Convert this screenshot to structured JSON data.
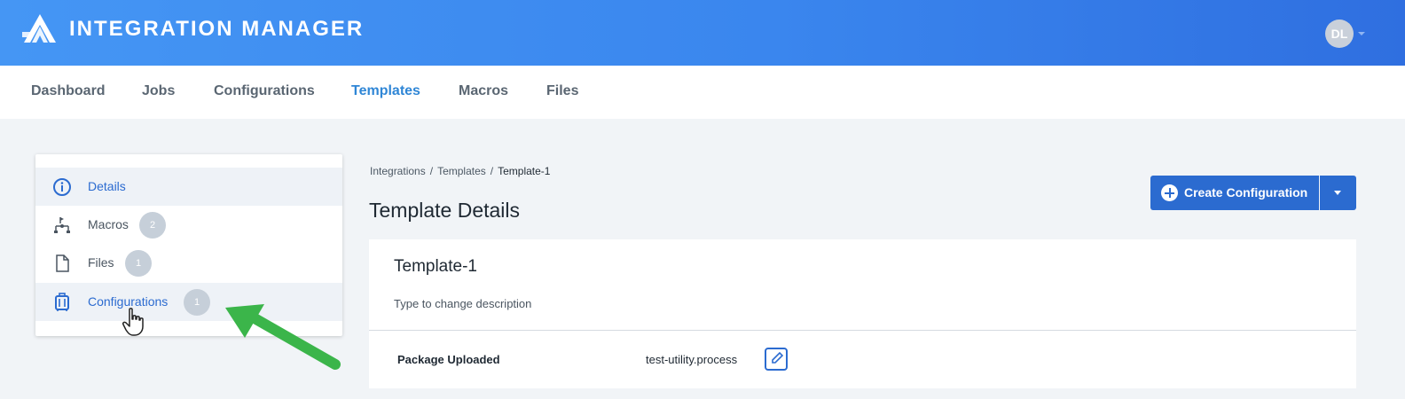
{
  "app": {
    "title": "INTEGRATION MANAGER",
    "logo_icon": "chevron-stack-logo",
    "user_initials": "DL"
  },
  "topnav": {
    "items": [
      {
        "label": "Dashboard",
        "active": false
      },
      {
        "label": "Jobs",
        "active": false
      },
      {
        "label": "Configurations",
        "active": false
      },
      {
        "label": "Templates",
        "active": true
      },
      {
        "label": "Macros",
        "active": false
      },
      {
        "label": "Files",
        "active": false
      }
    ]
  },
  "sidebar": {
    "items": [
      {
        "label": "Details",
        "icon": "info-icon",
        "badge": null
      },
      {
        "label": "Macros",
        "icon": "flowchart-icon",
        "badge": "2"
      },
      {
        "label": "Files",
        "icon": "file-icon",
        "badge": "1"
      },
      {
        "label": "Configurations",
        "icon": "luggage-icon",
        "badge": "1"
      }
    ]
  },
  "breadcrumb": {
    "items": [
      "Integrations",
      "Templates",
      "Template-1"
    ]
  },
  "page": {
    "title": "Template Details"
  },
  "actions": {
    "create_label": "Create Configuration"
  },
  "template": {
    "name": "Template-1",
    "description": "Type to change description",
    "package_label": "Package Uploaded",
    "package_value": "test-utility.process"
  },
  "colors": {
    "primary": "#2b6bd0",
    "header_start": "#4596f4",
    "header_end": "#2f6fe0",
    "nav_active": "#2f86d6",
    "annotation_arrow": "#3bb54a"
  }
}
